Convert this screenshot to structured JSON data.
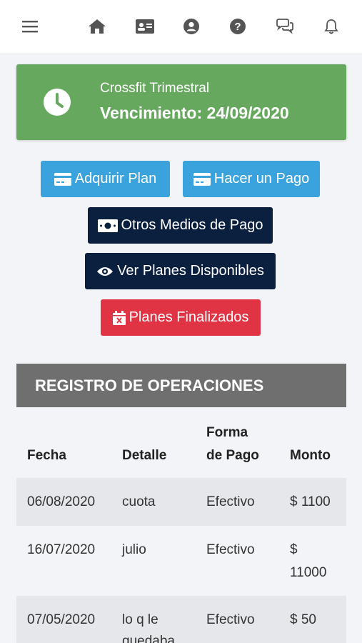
{
  "nav": {
    "icons": [
      "menu-icon",
      "home-icon",
      "id-card-icon",
      "user-icon",
      "help-icon",
      "chat-icon",
      "bell-icon"
    ]
  },
  "plan": {
    "name": "Crossfit Trimestral",
    "expiry": "Vencimiento: 24/09/2020",
    "color": "#67a85f"
  },
  "actions": {
    "adquirir": "Adquirir Plan",
    "pago": "Hacer un Pago",
    "otros": "Otros Medios de Pago",
    "ver": "Ver Planes Disponibles",
    "finalizados": "Planes Finalizados"
  },
  "colors": {
    "blue": "#3aa2dc",
    "navy": "#0b1f3f",
    "red": "#e03444",
    "header_gray": "#6f6f6f"
  },
  "registro": {
    "title": "REGISTRO DE OPERACIONES",
    "headers": {
      "fecha": "Fecha",
      "detalle": "Detalle",
      "forma_1": "Forma",
      "forma_2": "de Pago",
      "monto": "Monto"
    },
    "rows": [
      {
        "fecha": "06/08/2020",
        "detalle": [
          "cuota"
        ],
        "forma": "Efectivo",
        "monto": [
          "$ 1100"
        ]
      },
      {
        "fecha": "16/07/2020",
        "detalle": [
          "julio"
        ],
        "forma": "Efectivo",
        "monto": [
          "$",
          "11000"
        ]
      },
      {
        "fecha": "07/05/2020",
        "detalle": [
          "lo q le",
          "quedaba"
        ],
        "forma": "Efectivo",
        "monto": [
          "$ 50"
        ]
      }
    ]
  }
}
